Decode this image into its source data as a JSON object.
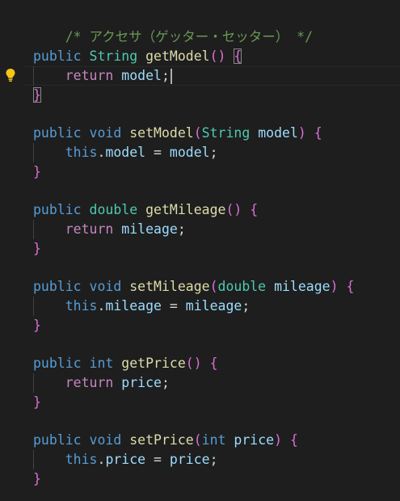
{
  "code": {
    "comment": "/* アクセサ（ゲッター・セッター） */",
    "kw_public": "public",
    "kw_void": "void",
    "kw_int": "int",
    "kw_double": "double",
    "kw_return": "return",
    "kw_this": "this",
    "type_string": "String",
    "fn_getModel": "getModel",
    "fn_setModel": "setModel",
    "fn_getMileage": "getMileage",
    "fn_setMileage": "setMileage",
    "fn_getPrice": "getPrice",
    "fn_setPrice": "setPrice",
    "var_model": "model",
    "var_mileage": "mileage",
    "var_price": "price",
    "open_paren": "(",
    "close_paren": ")",
    "empty_parens": "()",
    "open_brace": "{",
    "close_brace": "}",
    "semicolon": ";",
    "dot": ".",
    "equals": " = ",
    "space": " "
  },
  "icons": {
    "lightbulb": "lightbulb-icon",
    "lightbulb_color": "#f5c518"
  },
  "colors": {
    "background": "#1e1e1e",
    "keyword": "#569cd6",
    "control": "#c586c0",
    "type": "#4ec9b0",
    "function": "#dcdcaa",
    "variable": "#9cdcfe",
    "comment": "#6a9955",
    "bracket": "#da70d6"
  }
}
